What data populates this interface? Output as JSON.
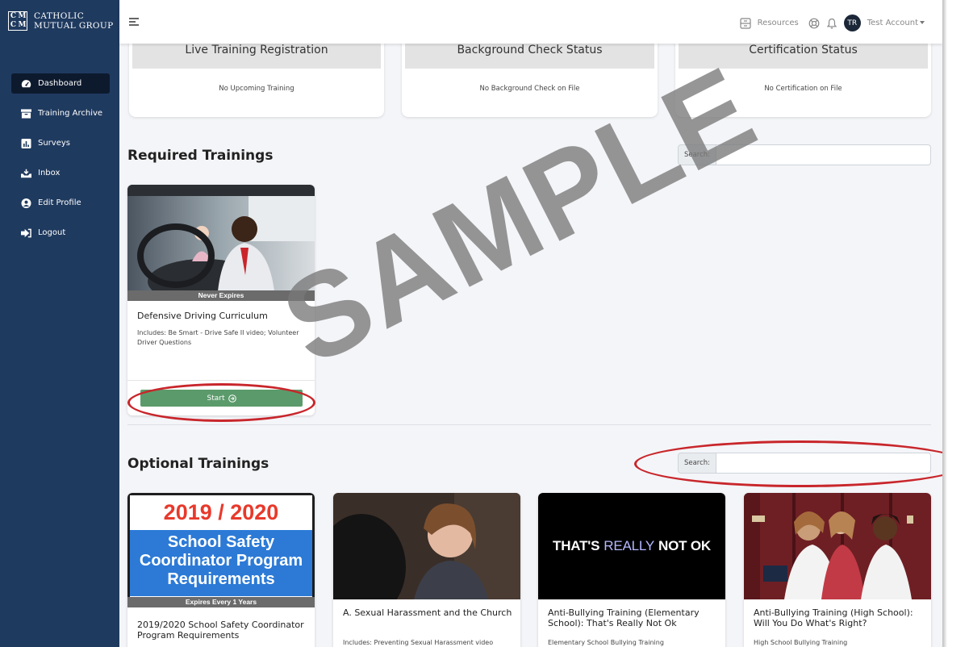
{
  "brand": {
    "logo_letters": [
      "C",
      "M",
      "C",
      "M"
    ],
    "name_line1": "CATHOLIC",
    "name_line2": "MUTUAL GROUP"
  },
  "sidebar": {
    "items": [
      {
        "label": "Dashboard",
        "icon": "tachometer-icon",
        "active": true
      },
      {
        "label": "Training Archive",
        "icon": "archive-icon"
      },
      {
        "label": "Surveys",
        "icon": "chart-icon"
      },
      {
        "label": "Inbox",
        "icon": "inbox-icon"
      },
      {
        "label": "Edit Profile",
        "icon": "user-circle-icon"
      },
      {
        "label": "Logout",
        "icon": "logout-icon"
      }
    ]
  },
  "topbar": {
    "resources_label": "Resources",
    "avatar_initials": "TR",
    "account_label": "Test Account"
  },
  "status_cards": [
    {
      "title": "Live Training Registration",
      "body": "No Upcoming Training"
    },
    {
      "title": "Background Check Status",
      "body": "No Background Check on File"
    },
    {
      "title": "Certification Status",
      "body": "No Certification on File"
    }
  ],
  "required": {
    "title": "Required Trainings",
    "search_label": "Search:",
    "card": {
      "ribbon": "Never Expires",
      "title": "Defensive Driving Curriculum",
      "description": "Includes: Be Smart - Drive Safe II video; Volunteer Driver Questions",
      "button": "Start"
    }
  },
  "optional": {
    "title": "Optional Trainings",
    "search_label": "Search:",
    "cards": [
      {
        "poster_year": "2019 / 2020",
        "poster_line1": "School Safety",
        "poster_line2": "Coordinator Program",
        "poster_line3": "Requirements",
        "ribbon": "Expires Every 1 Years",
        "title": "2019/2020 School Safety Coordinator Program Requirements"
      },
      {
        "title": "A. Sexual Harassment and the Church",
        "description": "Includes: Preventing Sexual Harassment video"
      },
      {
        "thumb_word1": "THAT'S",
        "thumb_word2": "REALLY",
        "thumb_word3": "NOT OK",
        "title": "Anti-Bullying Training (Elementary School): That's Really Not Ok",
        "description": "Elementary School Bullying Training"
      },
      {
        "title": "Anti-Bullying Training (High School): Will You Do What's Right?",
        "description": "High School Bullying Training"
      }
    ]
  },
  "watermark": "SAMPLE",
  "colors": {
    "sidebar": "#1f3a5f",
    "start_button": "#5b9b6b",
    "annotation": "#c8262b"
  }
}
